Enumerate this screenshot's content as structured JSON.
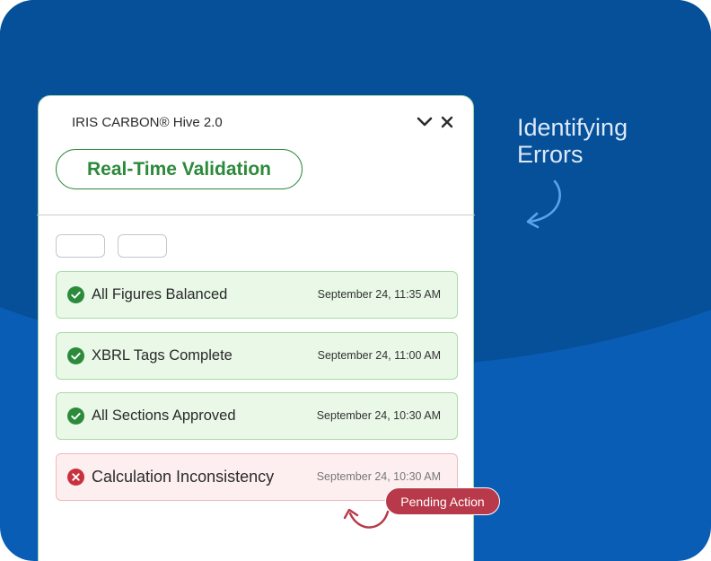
{
  "app": {
    "title": "IRIS CARBON® Hive 2.0",
    "feature_title": "Real-Time Validation"
  },
  "header_controls": [
    {
      "name": "collapse",
      "icon": "chevron-down-icon"
    },
    {
      "name": "close",
      "icon": "close-icon"
    }
  ],
  "filters": [
    {
      "label": ""
    },
    {
      "label": ""
    }
  ],
  "validations": [
    {
      "label": "All Figures Balanced",
      "time": "September 24, 11:35 AM",
      "status": "passed"
    },
    {
      "label": "XBRL Tags Complete",
      "time": "September 24, 11:00 AM",
      "status": "passed"
    },
    {
      "label": "All Sections Approved",
      "time": "September 24, 10:30 AM",
      "status": "passed"
    },
    {
      "label": "Calculation Inconsistency",
      "time": "September 24, 10:30 AM",
      "status": "failed"
    }
  ],
  "callout": {
    "line1": "Identifying",
    "line2": "Errors"
  },
  "badge": {
    "label": "Pending Action"
  },
  "colors": {
    "background_dark": "#064f99",
    "background_light": "#0a5db4",
    "success": "#2c8a3b",
    "success_bg": "#e9f8e7",
    "error": "#c8323e",
    "error_bg": "#fdeff0",
    "badge": "#b8394a",
    "callout_text": "#dce9f8",
    "arrow": "#5aa2ec"
  }
}
